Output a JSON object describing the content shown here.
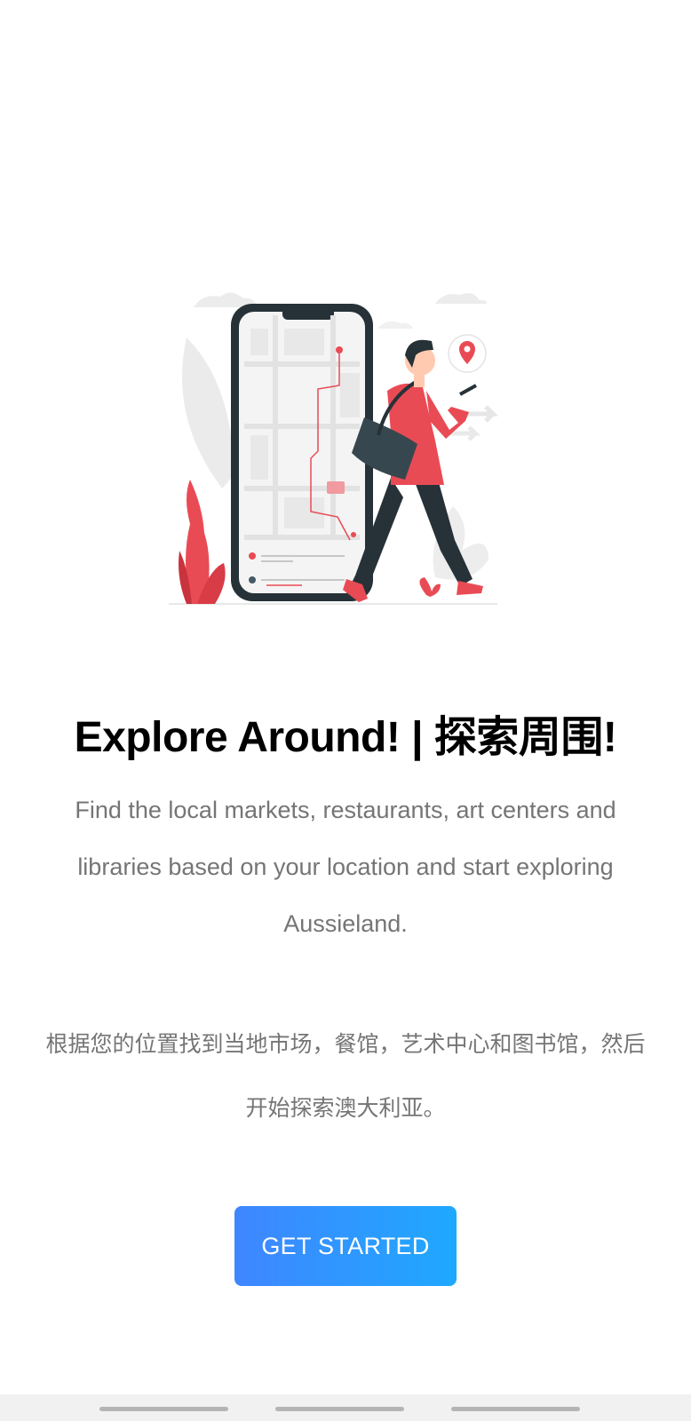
{
  "onboarding": {
    "title": "Explore Around! | 探索周围!",
    "description_en": "Find the local markets, restaurants, art centers and libraries based on your location and start exploring Aussieland.",
    "description_zh": "根据您的位置找到当地市场，餐馆，艺术中心和图书馆，然后开始探索澳大利亚。",
    "cta_label": "GET STARTED"
  },
  "illustration": {
    "icon": "person-walking-with-map-phone-illustration",
    "accent_color": "#e94b55",
    "dark_color": "#263238"
  },
  "colors": {
    "button_gradient_start": "#3f86ff",
    "button_gradient_end": "#1fa8ff",
    "body_text": "#757575",
    "title_text": "#000000"
  }
}
